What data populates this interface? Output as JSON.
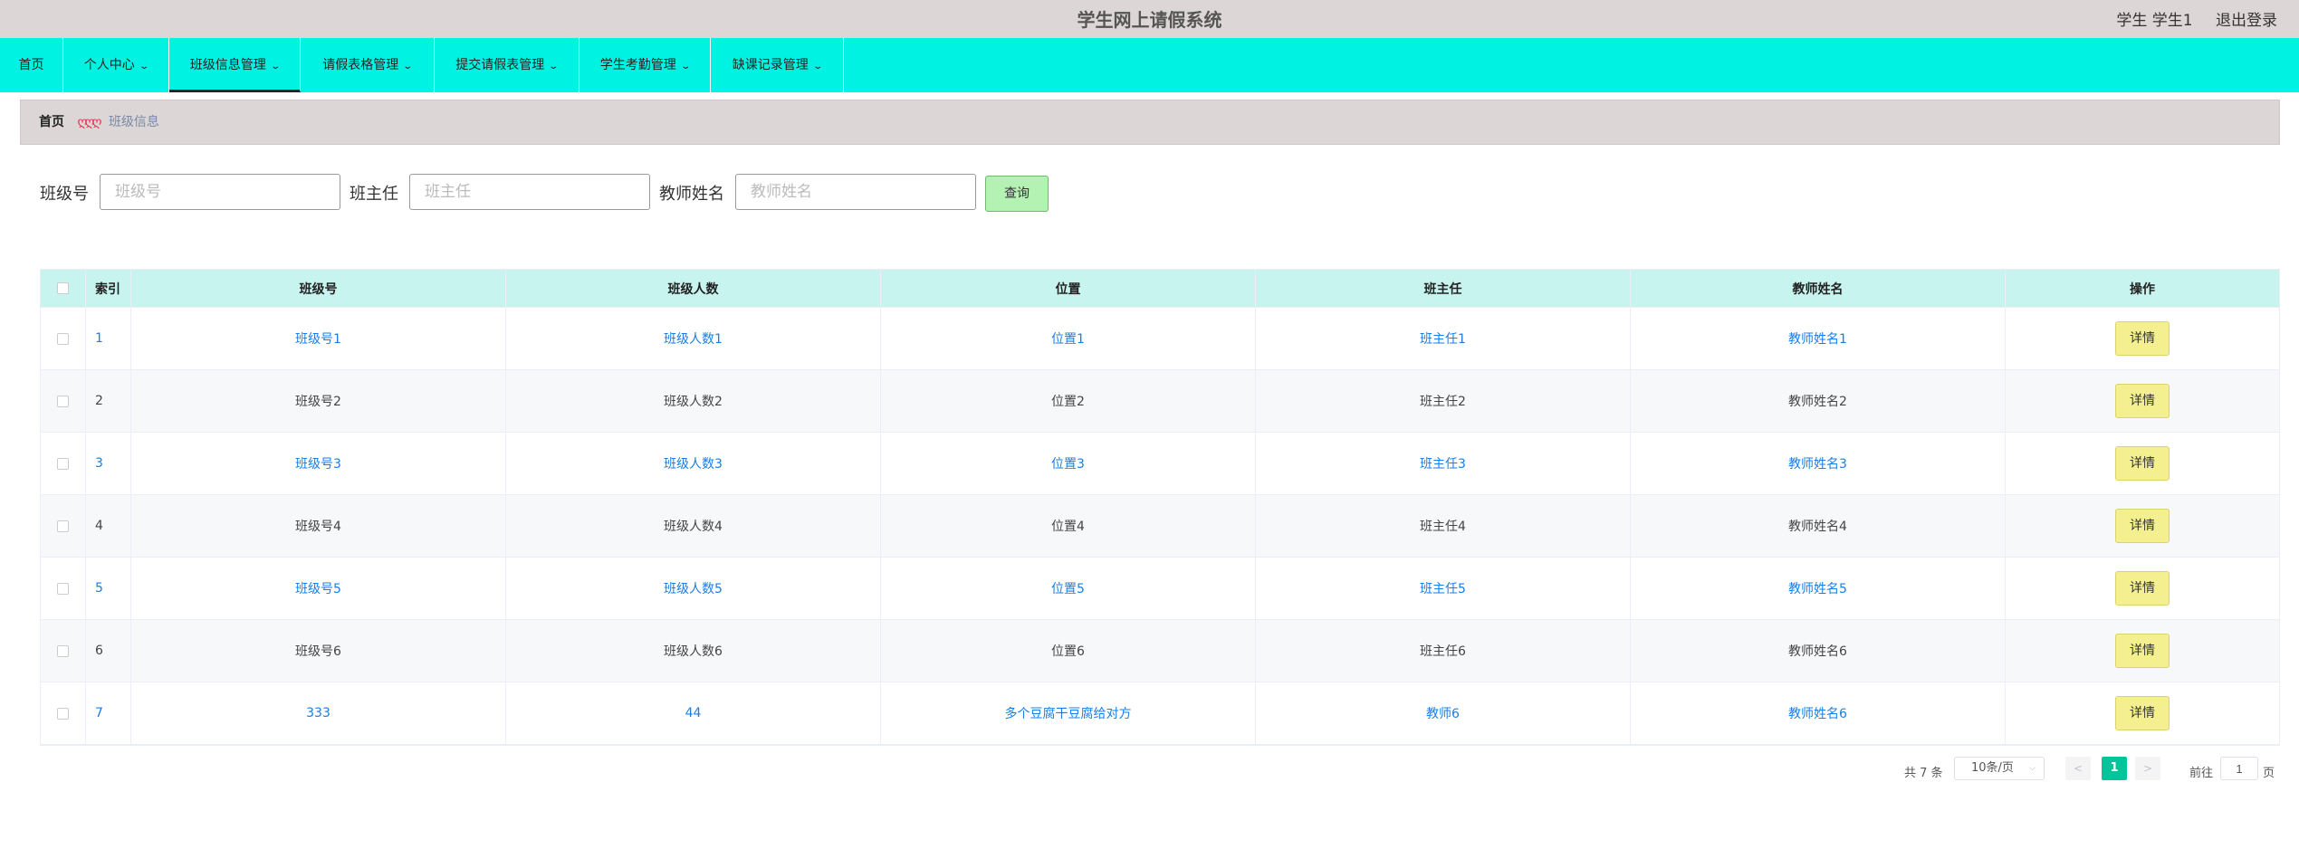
{
  "header": {
    "title": "学生网上请假系统",
    "user": "学生 学生1",
    "logout": "退出登录"
  },
  "nav": {
    "items": [
      {
        "label": "首页"
      },
      {
        "label": "个人中心"
      },
      {
        "label": "班级信息管理"
      },
      {
        "label": "请假表格管理"
      },
      {
        "label": "提交请假表管理"
      },
      {
        "label": "学生考勤管理"
      },
      {
        "label": "缺课记录管理"
      }
    ],
    "chevron": "⌄"
  },
  "breadcrumb": {
    "home": "首页",
    "separator": "ღღღ",
    "current": "班级信息"
  },
  "search": {
    "fields": [
      {
        "label": "班级号",
        "placeholder": "班级号"
      },
      {
        "label": "班主任",
        "placeholder": "班主任"
      },
      {
        "label": "教师姓名",
        "placeholder": "教师姓名"
      }
    ],
    "query": "查询"
  },
  "table": {
    "columns": [
      "索引",
      "班级号",
      "班级人数",
      "位置",
      "班主任",
      "教师姓名",
      "操作"
    ],
    "action_label": "详情",
    "rows": [
      [
        "1",
        "班级号1",
        "班级人数1",
        "位置1",
        "班主任1",
        "教师姓名1"
      ],
      [
        "2",
        "班级号2",
        "班级人数2",
        "位置2",
        "班主任2",
        "教师姓名2"
      ],
      [
        "3",
        "班级号3",
        "班级人数3",
        "位置3",
        "班主任3",
        "教师姓名3"
      ],
      [
        "4",
        "班级号4",
        "班级人数4",
        "位置4",
        "班主任4",
        "教师姓名4"
      ],
      [
        "5",
        "班级号5",
        "班级人数5",
        "位置5",
        "班主任5",
        "教师姓名5"
      ],
      [
        "6",
        "班级号6",
        "班级人数6",
        "位置6",
        "班主任6",
        "教师姓名6"
      ],
      [
        "7",
        "333",
        "44",
        "多个豆腐干豆腐给对方",
        "教师6",
        "教师姓名6"
      ]
    ]
  },
  "pagination": {
    "total": "共 7 条",
    "page_size": "10条/页",
    "prev": "<",
    "current": "1",
    "next": ">",
    "goto": "前往",
    "goto_value": "1",
    "page_suffix": "页"
  },
  "colors": {
    "navbar": "#00f2e3",
    "header_bg": "#ddd6d6",
    "table_head": "#c7f4ef",
    "link": "#1a7ee6",
    "query_button": "#b4f2b4",
    "detail_button": "#f4f090",
    "active_page": "#00c49a"
  }
}
